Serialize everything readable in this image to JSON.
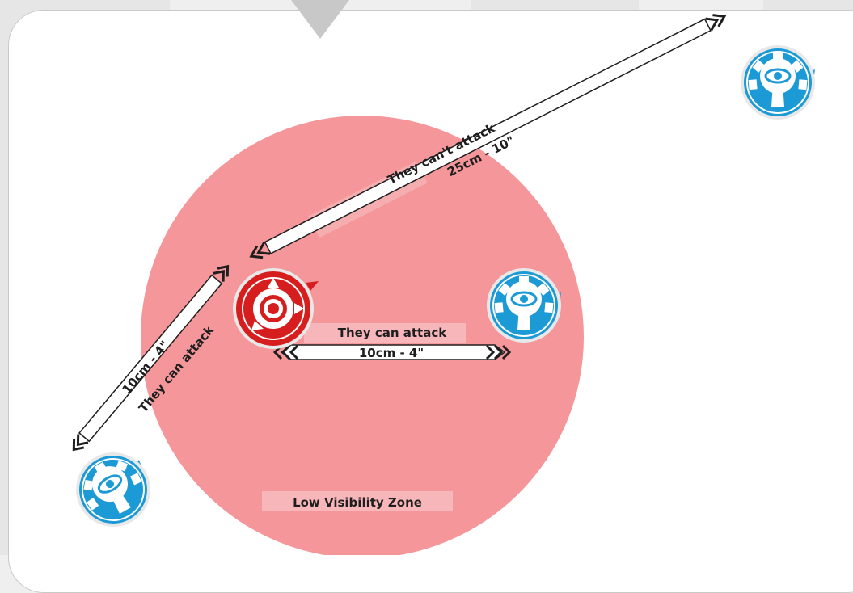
{
  "colors": {
    "zone_fill": "#f4969a",
    "zone_highlight": "#f7b6b9",
    "friendly_blue": "#1c9ad6",
    "enemy_red": "#d71e1e",
    "arrow_fill": "#ffffff",
    "arrow_stroke": "#1e1e1e",
    "card_background": "#ffffff",
    "page_background": "#efefef",
    "pointer": "#c8c8c8"
  },
  "icons": {
    "enemy": "red-target-token-icon",
    "friendly": "blue-eye-gear-token-icon",
    "pointer": "triangle-down-icon"
  },
  "zone": {
    "label": "Low Visibility Zone"
  },
  "ranges": {
    "far": {
      "status": "They can't attack",
      "distance": "25cm - 10\""
    },
    "near_right": {
      "status": "They can attack",
      "distance": "10cm - 4\""
    },
    "near_left": {
      "status": "They can attack",
      "distance": "10cm - 4\""
    }
  }
}
